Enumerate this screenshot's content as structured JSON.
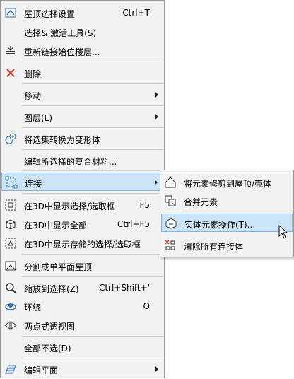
{
  "menu": {
    "items": [
      {
        "label": "屋顶选择设置",
        "shortcut": "Ctrl+T",
        "icon": "roof-settings-icon"
      },
      {
        "label": "选择& 激活工具(S)",
        "icon": ""
      },
      {
        "label": "重新链接始位楼层...",
        "icon": "relink-story-icon"
      },
      {
        "label": "删除",
        "icon": "delete-icon"
      },
      {
        "label": "移动",
        "icon": "",
        "submenu": true
      },
      {
        "label": "图层(L)",
        "icon": "",
        "submenu": true
      },
      {
        "label": "将选集转换为变形体",
        "icon": "convert-morph-icon"
      },
      {
        "label": "编辑所选择的复合材料...",
        "icon": ""
      },
      {
        "label": "连接",
        "icon": "connect-icon",
        "submenu": true
      },
      {
        "label": "在3D中显示选择/选取框",
        "shortcut": "F5",
        "icon": "show-3d-selection-icon"
      },
      {
        "label": "在3D中显示全部",
        "shortcut": "Ctrl+F5",
        "icon": "show-3d-all-icon"
      },
      {
        "label": "在3D中显示存储的选择/选取框",
        "icon": "show-3d-stored-icon"
      },
      {
        "label": "分割成单平面屋顶",
        "icon": "split-roof-icon"
      },
      {
        "label": "缩放到选择(Z)",
        "shortcut": "Ctrl+Shift+'",
        "icon": "zoom-selection-icon"
      },
      {
        "label": "环绕",
        "shortcut": "O",
        "icon": "orbit-icon"
      },
      {
        "label": "两点式透视图",
        "icon": "two-point-perspective-icon"
      },
      {
        "label": "全部不选(D)",
        "icon": ""
      },
      {
        "label": "编辑平面",
        "icon": "edit-plane-icon",
        "submenu": true
      }
    ]
  },
  "submenu": {
    "items": [
      {
        "label": "将元素修剪到屋顶/壳体",
        "icon": "trim-to-roof-icon"
      },
      {
        "label": "合并元素",
        "icon": "merge-elements-icon"
      },
      {
        "label": "实体元素操作(T)...",
        "icon": "solid-operations-icon"
      },
      {
        "label": "清除所有连接体",
        "icon": "clear-connections-icon"
      }
    ]
  },
  "colors": {
    "highlight": "#cce4f7",
    "highlight_border": "#7eb4ea",
    "delete_red": "#e0352b",
    "icon_blue": "#2f6db3"
  }
}
